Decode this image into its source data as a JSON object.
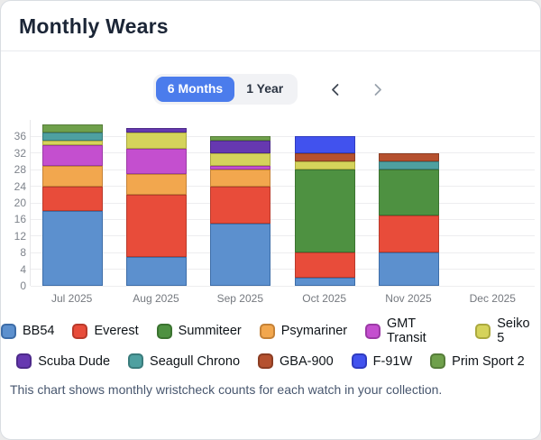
{
  "header": {
    "title": "Monthly Wears"
  },
  "controls": {
    "range_toggle": [
      {
        "label": "6 Months",
        "active": true
      },
      {
        "label": "1 Year",
        "active": false
      }
    ],
    "prev_arrow": "‹",
    "next_arrow": "›",
    "prev_color": "#3f4753",
    "next_color": "#9aa3ad"
  },
  "accent_color": "#4b7cec",
  "chart_data": {
    "type": "bar",
    "stacked": true,
    "title": "Monthly Wears",
    "categories": [
      "Jul 2025",
      "Aug 2025",
      "Sep 2025",
      "Oct 2025",
      "Nov 2025",
      "Dec 2025"
    ],
    "series": [
      {
        "name": "BB54",
        "color": "#5c90ce",
        "border": "#3d6da8",
        "values": [
          18,
          7,
          15,
          2,
          8,
          0
        ]
      },
      {
        "name": "Everest",
        "color": "#e84c3a",
        "border": "#b93a2b",
        "values": [
          6,
          15,
          9,
          6,
          9,
          0
        ]
      },
      {
        "name": "Summiteer",
        "color": "#4e9141",
        "border": "#3b7330",
        "values": [
          0,
          0,
          0,
          20,
          11,
          0
        ]
      },
      {
        "name": "Psymariner",
        "color": "#f2a74e",
        "border": "#c58237",
        "values": [
          5,
          5,
          4,
          0,
          0,
          0
        ]
      },
      {
        "name": "GMT Transit",
        "color": "#c44fcf",
        "border": "#9c3aa6",
        "values": [
          5,
          6,
          1,
          0,
          0,
          0
        ]
      },
      {
        "name": "Seiko 5",
        "color": "#d5d35b",
        "border": "#aba93f",
        "values": [
          1,
          4,
          3,
          2,
          0,
          0
        ]
      },
      {
        "name": "Scuba Dude",
        "color": "#6638b0",
        "border": "#4d2a8a",
        "values": [
          0,
          1,
          3,
          0,
          0,
          0
        ]
      },
      {
        "name": "Seagull Chrono",
        "color": "#4ea0a0",
        "border": "#3a7c7c",
        "values": [
          2,
          0,
          0,
          0,
          2,
          0
        ]
      },
      {
        "name": "GBA-900",
        "color": "#b5512f",
        "border": "#8c3d23",
        "values": [
          0,
          0,
          0,
          2,
          2,
          0
        ]
      },
      {
        "name": "F-91W",
        "color": "#4152ee",
        "border": "#2f3bc0",
        "values": [
          0,
          0,
          0,
          4,
          0,
          0
        ]
      },
      {
        "name": "Prim Sport 2",
        "color": "#6fa04b",
        "border": "#567d39",
        "values": [
          2,
          0,
          1,
          0,
          0,
          0
        ]
      }
    ],
    "totals": {
      "Jul 2025": 39,
      "Aug 2025": 38,
      "Sep 2025": 36,
      "Oct 2025": 36,
      "Nov 2025": 32,
      "Dec 2025": 0
    },
    "y_ticks": [
      0,
      4,
      8,
      12,
      16,
      20,
      24,
      28,
      32,
      36
    ],
    "ylim": [
      0,
      40
    ],
    "xlabel": "",
    "ylabel": "",
    "grid": true,
    "legend_position": "bottom",
    "legend_rows": [
      [
        0,
        1,
        2,
        3,
        4,
        5
      ],
      [
        6,
        7,
        8,
        9,
        10
      ]
    ]
  },
  "footer": {
    "caption": "This chart shows monthly wristcheck counts for each watch in your collection."
  }
}
